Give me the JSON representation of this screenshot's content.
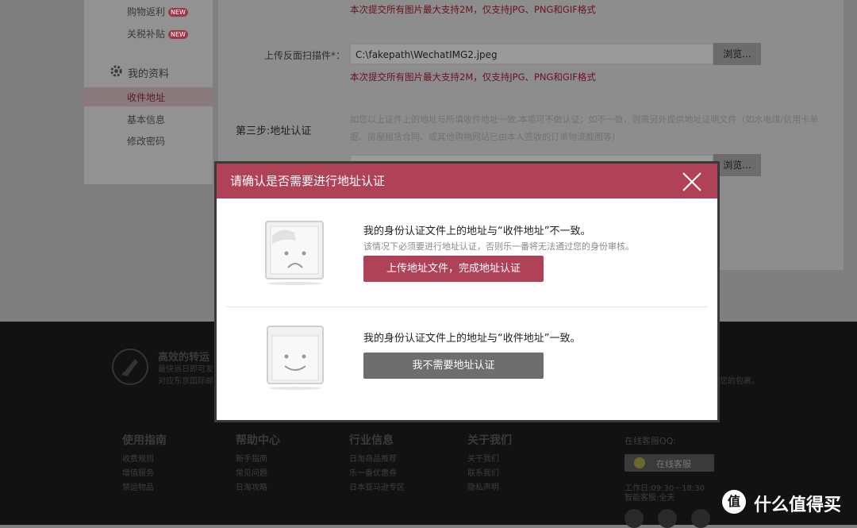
{
  "sidebar": {
    "links": [
      {
        "label": "购物返利",
        "badge": "NEW"
      },
      {
        "label": "关税补贴",
        "badge": "NEW"
      }
    ],
    "section_title": "我的资料",
    "items": [
      {
        "label": "收件地址"
      },
      {
        "label": "基本信息"
      },
      {
        "label": "修改密码"
      }
    ]
  },
  "form": {
    "note_top": "本次提交所有图片最大支持2M，仅支持JPG、PNG和GIF格式",
    "back_scan_label": "上传反面扫描件*：",
    "back_scan_value": "C:\\fakepath\\WechatIMG2.jpeg",
    "browse_label": "浏览...",
    "note_back": "本次提交所有图片最大支持2M，仅支持JPG、PNG和GIF格式",
    "step3_title": "第三步:地址认证",
    "step3_desc": "如您以上证件上的地址与所填收件地址一致,本项可不做认证；如不一致，则需另外提供地址证明文件（如水电煤/信用卡单据、房屋租赁合同、或其他购物网站已由本人签收的订单物流截图等)",
    "browse_label_2": "浏览..."
  },
  "footer": {
    "promo_title": "高效的转运",
    "promo_line1": "最快当日即可发",
    "promo_line2": "对应东京国际邮",
    "promo_right": "您的包裹。",
    "columns": [
      {
        "title": "使用指南",
        "links": [
          "收费规则",
          "增值服务",
          "禁运物品"
        ]
      },
      {
        "title": "帮助中心",
        "links": [
          "新手指南",
          "常见问题",
          "日淘攻略"
        ]
      },
      {
        "title": "行业信息",
        "links": [
          "日淘商品推荐",
          "乐一番优惠券",
          "日本亚马逊专区"
        ]
      },
      {
        "title": "关于我们",
        "links": [
          "关于我们",
          "联系我们",
          "隐私声明"
        ]
      }
    ],
    "qq_label": "在线客服QQ:",
    "qq_button": "在线客服",
    "hours": "工作日:09:30－18:30",
    "bot": "智能客服:全天"
  },
  "modal": {
    "title": "请确认是否需要进行地址认证",
    "option1_message": "我的身份认证文件上的地址与“收件地址”不一致。",
    "option1_sub": "该情况下必须要进行地址认证，否则乐一番将无法通过您的身份审核。",
    "option1_button": "上传地址文件，完成地址认证",
    "option2_message": "我的身份认证文件上的地址与“收件地址”一致。",
    "option2_button": "我不需要地址认证"
  },
  "watermark": {
    "text": "什么值得买",
    "icon": "值"
  },
  "colors": {
    "accent": "#b04258",
    "gray_button": "#6e6e6e"
  }
}
